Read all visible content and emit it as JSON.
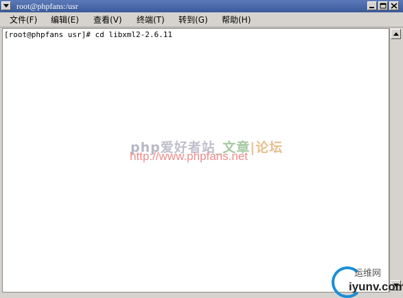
{
  "window": {
    "title": "root@phpfans:/usr"
  },
  "menubar": {
    "items": [
      {
        "label": "文件(F)"
      },
      {
        "label": "编辑(E)"
      },
      {
        "label": "查看(V)"
      },
      {
        "label": "终端(T)"
      },
      {
        "label": "转到(G)"
      },
      {
        "label": "帮助(H)"
      }
    ]
  },
  "terminal": {
    "line1": "[root@phpfans usr]# cd libxml2-2.6.11"
  },
  "watermark": {
    "part1": "php",
    "part2": "爱好者站",
    "part3": "_文章",
    "part4": "|论坛",
    "url": "http://www.phpfans.net"
  },
  "logo": {
    "top": "运维网",
    "bottom": "iyunv.com"
  },
  "colors": {
    "titlebar": "#3a5a9a",
    "chrome": "#d6d3ce",
    "terminal_bg": "#ffffff"
  }
}
